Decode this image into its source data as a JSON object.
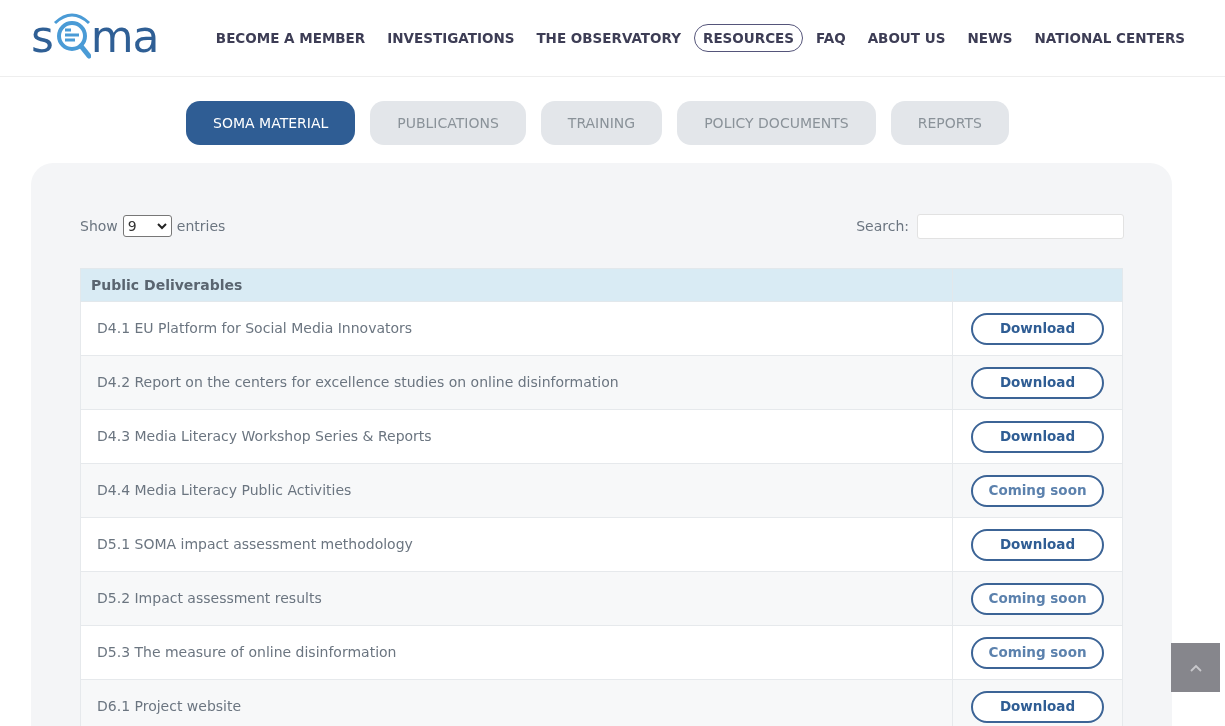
{
  "logo": {
    "before": "s",
    "after": "ma"
  },
  "nav": [
    {
      "label": "BECOME A MEMBER",
      "selected": false
    },
    {
      "label": "INVESTIGATIONS",
      "selected": false
    },
    {
      "label": "THE OBSERVATORY",
      "selected": false
    },
    {
      "label": "RESOURCES",
      "selected": true
    },
    {
      "label": "FAQ",
      "selected": false
    },
    {
      "label": "ABOUT US",
      "selected": false
    },
    {
      "label": "NEWS",
      "selected": false
    },
    {
      "label": "NATIONAL CENTERS",
      "selected": false
    }
  ],
  "tabs": [
    {
      "label": "SOMA MATERIAL",
      "selected": true
    },
    {
      "label": "PUBLICATIONS",
      "selected": false
    },
    {
      "label": "TRAINING",
      "selected": false
    },
    {
      "label": "POLICY DOCUMENTS",
      "selected": false
    },
    {
      "label": "REPORTS",
      "selected": false
    }
  ],
  "length": {
    "before": "Show",
    "value": "9",
    "after": "entries"
  },
  "search": {
    "label": "Search:"
  },
  "table": {
    "columns": [
      "Public Deliverables"
    ],
    "rows": [
      {
        "title": "D4.1 EU Platform for Social Media Innovators",
        "action": {
          "kind": "download",
          "label": "Download"
        }
      },
      {
        "title": "D4.2 Report on the centers for excellence studies on online disinformation",
        "action": {
          "kind": "download",
          "label": "Download"
        }
      },
      {
        "title": "D4.3 Media Literacy Workshop Series & Reports",
        "action": {
          "kind": "download",
          "label": "Download"
        }
      },
      {
        "title": "D4.4 Media Literacy Public Activities",
        "action": {
          "kind": "coming_soon",
          "label": "Coming soon"
        }
      },
      {
        "title": "D5.1 SOMA impact assessment methodology",
        "action": {
          "kind": "download",
          "label": "Download"
        }
      },
      {
        "title": "D5.2 Impact assessment results",
        "action": {
          "kind": "coming_soon",
          "label": "Coming soon"
        }
      },
      {
        "title": "D5.3 The measure of online disinformation",
        "action": {
          "kind": "coming_soon",
          "label": "Coming soon"
        }
      },
      {
        "title": "D6.1 Project website",
        "action": {
          "kind": "download",
          "label": "Download"
        }
      }
    ]
  }
}
